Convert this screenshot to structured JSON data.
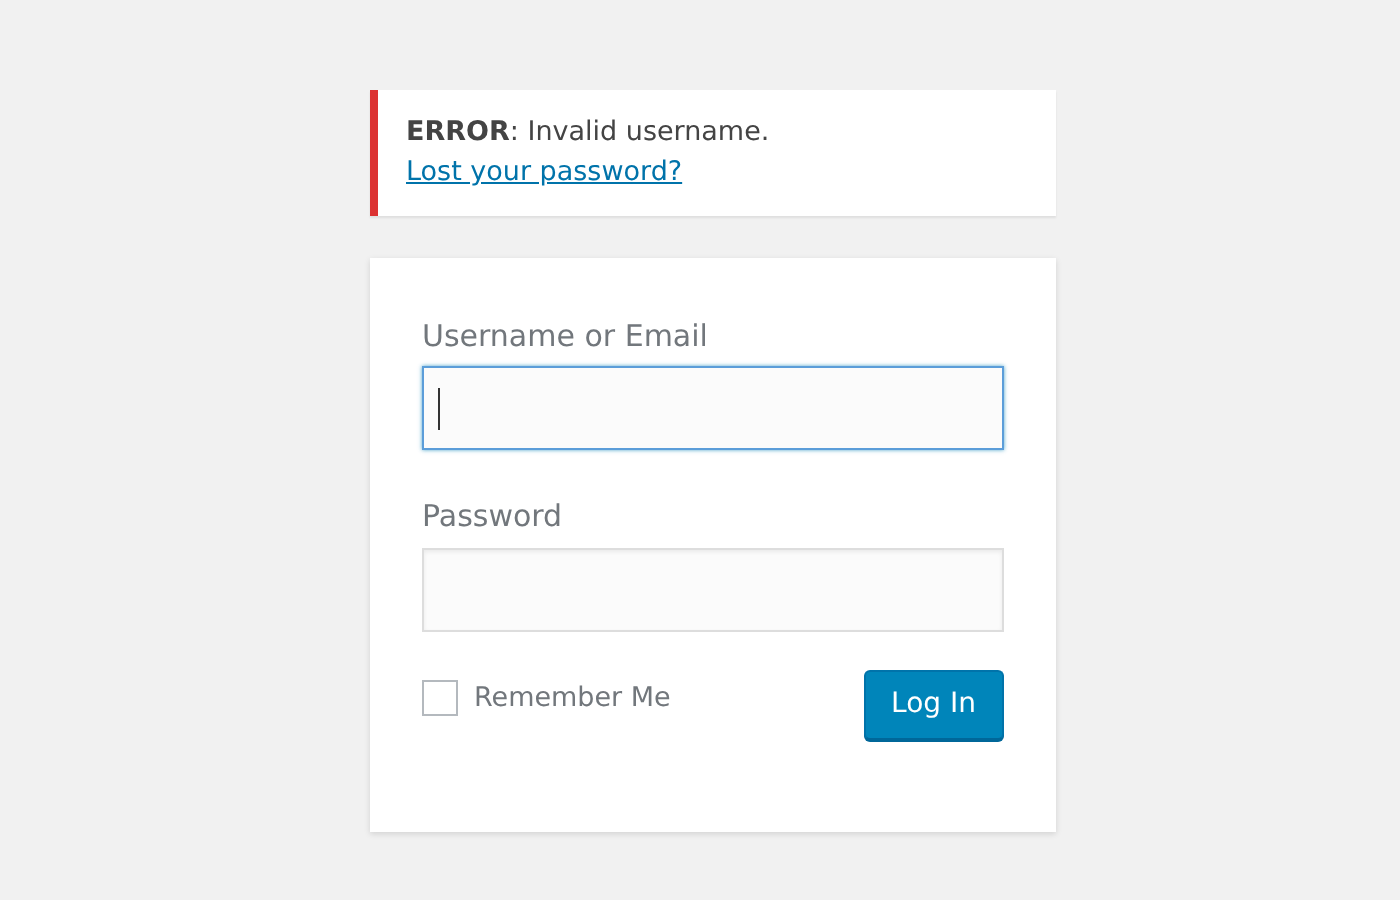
{
  "notice": {
    "message": "**ERROR**: Invalid username.",
    "link": "Lost your password?"
  },
  "form": {
    "fields": [
      {
        "label": "Username or Email",
        "focused": true
      },
      {
        "label": "Password",
        "focused": false
      }
    ],
    "remember": {
      "label": "Remember Me",
      "checked": false
    },
    "submit": "Log In"
  }
}
